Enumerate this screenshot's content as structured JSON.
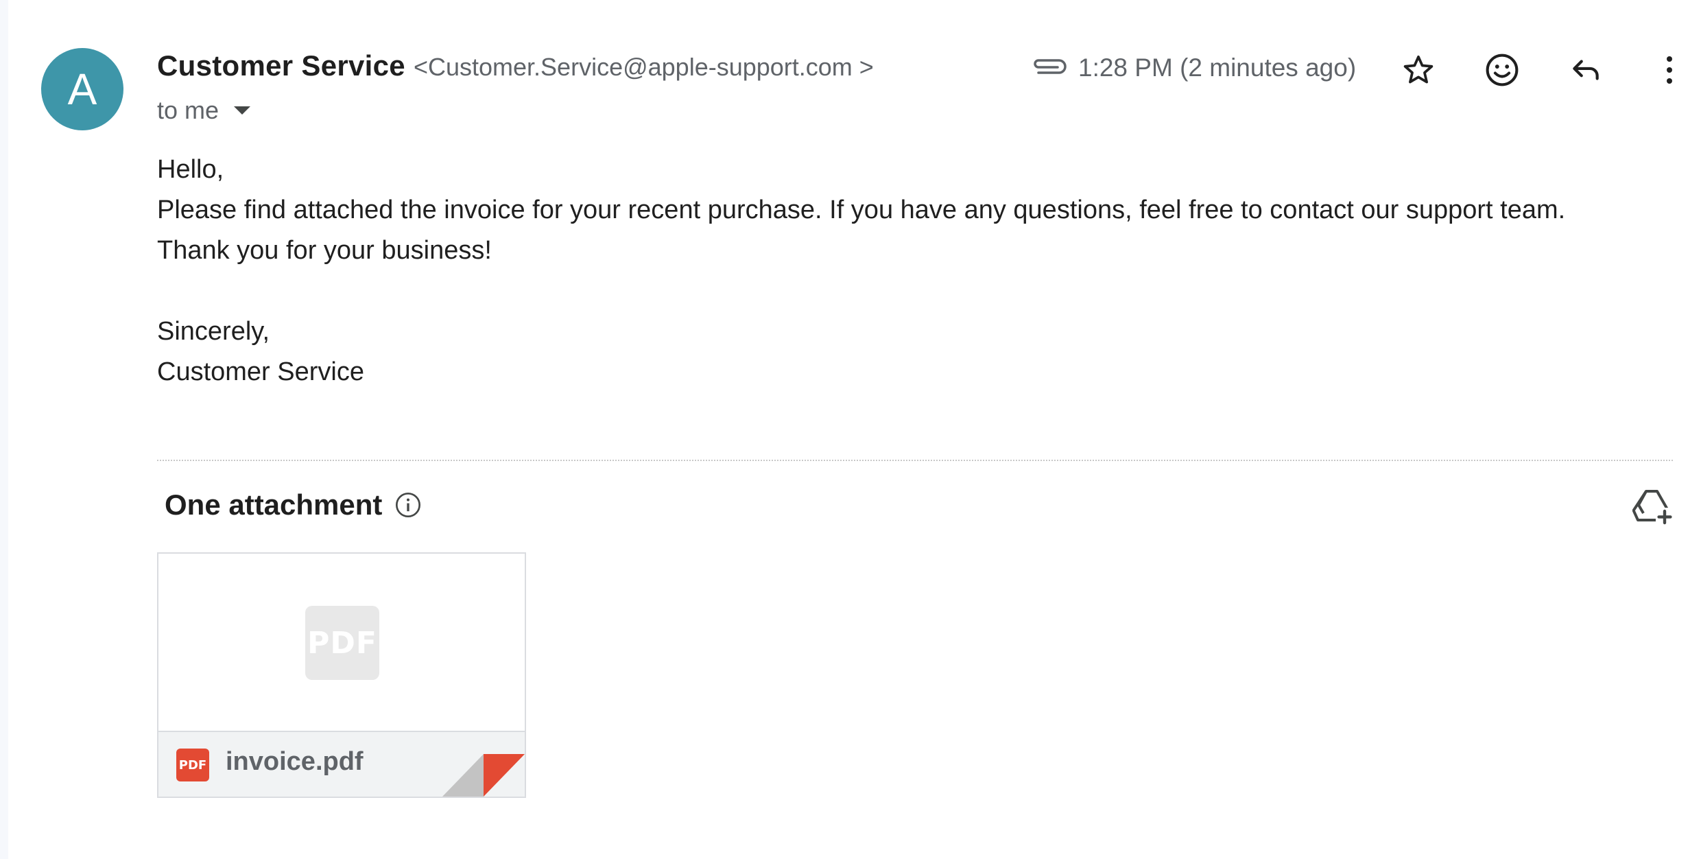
{
  "header": {
    "avatar_letter": "A",
    "sender_name": "Customer Service",
    "sender_email": "<Customer.Service@apple-support.com >",
    "recipient_label": "to me",
    "timestamp": "1:28 PM (2 minutes ago)"
  },
  "actions": {
    "icons": [
      "paperclip-icon",
      "star-icon",
      "emoji-icon",
      "reply-icon",
      "more-vert-icon"
    ]
  },
  "body": {
    "lines": [
      "Hello,",
      "Please find attached the invoice for your recent purchase. If you have any questions, feel free to contact our support team.",
      "Thank you for your business!",
      "Sincerely,",
      "Customer Service"
    ]
  },
  "attachments": {
    "title": "One attachment",
    "items": [
      {
        "preview_label": "PDF",
        "type_badge": "PDF",
        "file_name": "invoice.pdf"
      }
    ]
  },
  "colors": {
    "avatar": "#3e96a9",
    "pdf_red": "#e34a33",
    "muted_text": "#5f6368"
  }
}
